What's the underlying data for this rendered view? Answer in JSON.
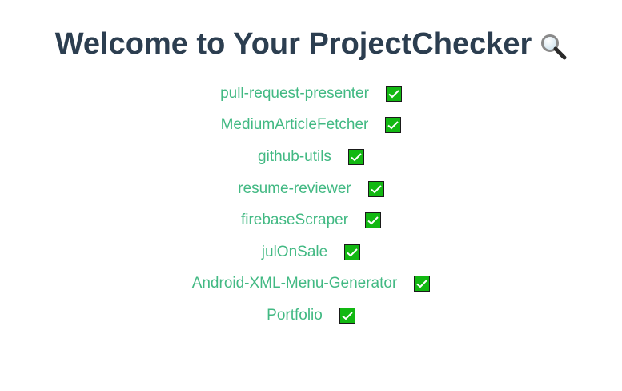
{
  "header": {
    "title": "Welcome to Your ProjectChecker",
    "icon": "magnifying-glass-icon"
  },
  "projects": [
    {
      "name": "pull-request-presenter",
      "status": "checked"
    },
    {
      "name": "MediumArticleFetcher",
      "status": "checked"
    },
    {
      "name": "github-utils",
      "status": "checked"
    },
    {
      "name": "resume-reviewer",
      "status": "checked"
    },
    {
      "name": "firebaseScraper",
      "status": "checked"
    },
    {
      "name": "julOnSale",
      "status": "checked"
    },
    {
      "name": "Android-XML-Menu-Generator",
      "status": "checked"
    },
    {
      "name": "Portfolio",
      "status": "checked"
    }
  ],
  "colors": {
    "title": "#2c3e50",
    "link": "#42b983",
    "check_bg": "#12b812"
  }
}
